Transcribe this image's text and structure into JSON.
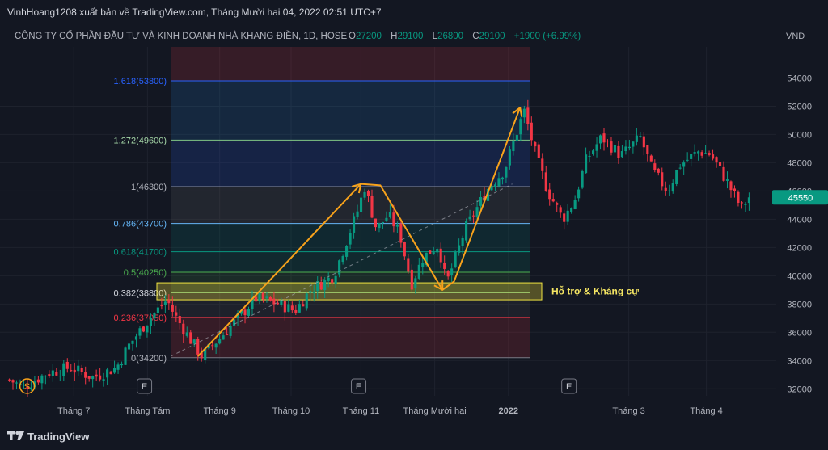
{
  "header": {
    "publish_line": "VinhHoang1208 xuất bản về TradingView.com, Tháng Mười hai 04, 2022 02:51 UTC+7",
    "symbol_line": "CÔNG TY CỔ PHẦN ĐẦU TƯ VÀ KINH DOANH NHÀ KHANG ĐIỀN, 1D, HOSE",
    "ohlc": [
      {
        "label": "O",
        "value": "27200"
      },
      {
        "label": "H",
        "value": "29100"
      },
      {
        "label": "L",
        "value": "26800"
      },
      {
        "label": "C",
        "value": "29100"
      }
    ],
    "change": "+1900 (+6.99%)"
  },
  "footer": {
    "brand": "TradingView"
  },
  "chart_data": {
    "type": "candlestick",
    "currency_label": "VND",
    "ylim": [
      31500,
      56200
    ],
    "y_ticks": [
      32000,
      34000,
      36000,
      38000,
      40000,
      42000,
      44000,
      46000,
      48000,
      50000,
      52000,
      54000
    ],
    "x_labels": [
      {
        "label": "Tháng 7",
        "pos": 0.095
      },
      {
        "label": "Tháng Tám",
        "pos": 0.19
      },
      {
        "label": "Tháng 9",
        "pos": 0.283
      },
      {
        "label": "Tháng 10",
        "pos": 0.375
      },
      {
        "label": "Tháng 11",
        "pos": 0.465
      },
      {
        "label": "Tháng Mười hai",
        "pos": 0.56
      },
      {
        "label": "2022",
        "pos": 0.655
      },
      {
        "label": "Tháng 3",
        "pos": 0.81
      },
      {
        "label": "Tháng 4",
        "pos": 0.91
      }
    ],
    "price_label": "45550",
    "last_price": 45550,
    "fib_levels": [
      {
        "label": "0(34200)",
        "value": 34200,
        "line": "#787b86",
        "text": "#b2b5be",
        "fill": "rgba(242,54,69,0.16)"
      },
      {
        "label": "0.236(37050)",
        "value": 37050,
        "line": "#f23645",
        "text": "#f23645",
        "fill": "rgba(130,130,130,0.10)"
      },
      {
        "label": "0.382(38800)",
        "value": 38800,
        "line": "#81c784",
        "text": "#d1d4dc",
        "fill": "rgba(76,175,80,0.14)"
      },
      {
        "label": "0.5(40250)",
        "value": 40250,
        "line": "#4caf50",
        "text": "#4caf50",
        "fill": "rgba(8,153,129,0.14)"
      },
      {
        "label": "0.618(41700)",
        "value": 41700,
        "line": "#089981",
        "text": "#089981",
        "fill": "rgba(0,150,136,0.14)"
      },
      {
        "label": "0.786(43700)",
        "value": 43700,
        "line": "#64b5f6",
        "text": "#64b5f6",
        "fill": "rgba(120,120,120,0.16)"
      },
      {
        "label": "1(46300)",
        "value": 46300,
        "line": "#b2b5be",
        "text": "#b2b5be",
        "fill": "rgba(41,98,255,0.16)"
      },
      {
        "label": "1.272(49600)",
        "value": 49600,
        "line": "#81c784",
        "text": "#a5d6a7",
        "fill": "rgba(33,150,243,0.14)"
      },
      {
        "label": "1.618(53800)",
        "value": 53800,
        "line": "#2962ff",
        "text": "#2962ff",
        "fill": "rgba(242,54,69,0.16)"
      }
    ],
    "fib_top_value": 56200,
    "zone": {
      "label": "Hỗ trợ & Kháng cự",
      "top": 39500,
      "bottom": 38300
    },
    "arrow_path": [
      [
        0.255,
        34300
      ],
      [
        0.465,
        46500
      ],
      [
        0.49,
        46400
      ],
      [
        0.57,
        39000
      ],
      [
        0.585,
        39600
      ],
      [
        0.67,
        51900
      ]
    ],
    "trend_line": [
      [
        0.22,
        34300
      ],
      [
        0.66,
        46500
      ]
    ],
    "events": [
      {
        "kind": "dividend",
        "label": "S",
        "pos": 0.035
      },
      {
        "kind": "earnings",
        "label": "E",
        "pos": 0.186
      },
      {
        "kind": "earnings",
        "label": "E",
        "pos": 0.462
      },
      {
        "kind": "earnings",
        "label": "E",
        "pos": 0.733
      }
    ],
    "anchors": [
      [
        0.0,
        33000
      ],
      [
        0.03,
        32100
      ],
      [
        0.06,
        33100
      ],
      [
        0.09,
        33500
      ],
      [
        0.12,
        32800
      ],
      [
        0.15,
        33500
      ],
      [
        0.165,
        35000
      ],
      [
        0.19,
        36800
      ],
      [
        0.215,
        38300
      ],
      [
        0.225,
        37200
      ],
      [
        0.245,
        35500
      ],
      [
        0.26,
        34300
      ],
      [
        0.29,
        36000
      ],
      [
        0.33,
        38400
      ],
      [
        0.36,
        38000
      ],
      [
        0.38,
        37500
      ],
      [
        0.4,
        39000
      ],
      [
        0.43,
        40000
      ],
      [
        0.46,
        44500
      ],
      [
        0.47,
        46300
      ],
      [
        0.485,
        43300
      ],
      [
        0.5,
        44300
      ],
      [
        0.515,
        43000
      ],
      [
        0.53,
        39400
      ],
      [
        0.545,
        41300
      ],
      [
        0.565,
        42200
      ],
      [
        0.575,
        39400
      ],
      [
        0.6,
        43400
      ],
      [
        0.63,
        46300
      ],
      [
        0.65,
        47500
      ],
      [
        0.675,
        51700
      ],
      [
        0.69,
        48600
      ],
      [
        0.705,
        46100
      ],
      [
        0.725,
        44000
      ],
      [
        0.74,
        45300
      ],
      [
        0.755,
        48200
      ],
      [
        0.775,
        49800
      ],
      [
        0.8,
        48500
      ],
      [
        0.825,
        49800
      ],
      [
        0.84,
        47500
      ],
      [
        0.86,
        46000
      ],
      [
        0.875,
        47800
      ],
      [
        0.9,
        48800
      ],
      [
        0.915,
        48600
      ],
      [
        0.935,
        46800
      ],
      [
        0.955,
        44800
      ],
      [
        0.965,
        45550
      ]
    ]
  }
}
